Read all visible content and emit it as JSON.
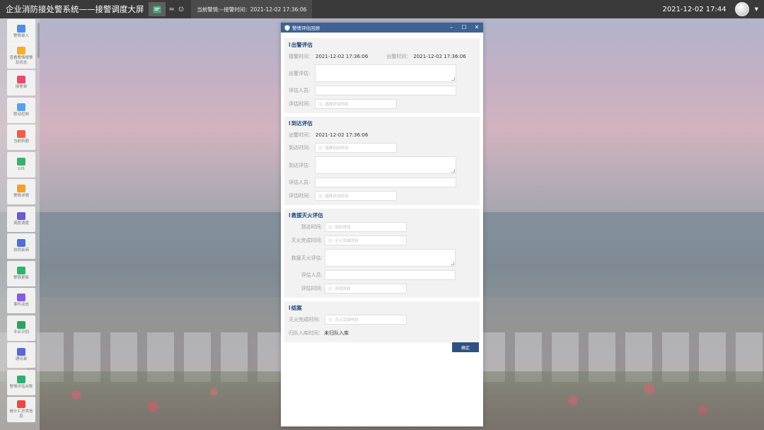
{
  "header": {
    "app_title": "企业消防接处警系统——接警调度大屏",
    "current_alert": "当前警情:--接警时间：2021-12-02 17:36:06",
    "datetime": "2021-12-02 17:44"
  },
  "sidebar": {
    "items": [
      {
        "label": "警情录入",
        "icon": "upload-icon",
        "color": "#4f8fe0"
      },
      {
        "label": "查看警情报警及状态",
        "icon": "bell-icon",
        "color": "#f0b030"
      },
      {
        "label": "接警单",
        "icon": "form-icon",
        "color": "#e84a6a"
      },
      {
        "label": "联动控制",
        "icon": "database-icon",
        "color": "#5aa0e8"
      },
      {
        "label": "当前执勤",
        "icon": "duty-icon",
        "color": "#e8604a"
      },
      {
        "label": "GIS",
        "icon": "map-pin-icon",
        "color": "#38b070"
      },
      {
        "label": "警情详情",
        "icon": "list-icon",
        "color": "#f0a030"
      },
      {
        "label": "调度调度",
        "icon": "hexagon-icon",
        "color": "#6a5ad0"
      },
      {
        "label": "协同会商",
        "icon": "meeting-icon",
        "color": "#4f70d0"
      },
      {
        "label": "警情更新",
        "icon": "refresh-icon",
        "color": "#30b070"
      },
      {
        "label": "事件动态",
        "icon": "share-icon",
        "color": "#8a5ae0"
      },
      {
        "label": "专业识别",
        "icon": "book-icon",
        "color": "#30a060"
      },
      {
        "label": "通讯录",
        "icon": "contacts-icon",
        "color": "#5a6ad0"
      },
      {
        "label": "警情评估台账",
        "icon": "evaluation-icon",
        "color": "#30b070"
      },
      {
        "label": "统计汇总类信息",
        "icon": "stats-icon",
        "color": "#e84a4a"
      }
    ]
  },
  "dialog": {
    "title": "警情评估回顾",
    "confirm_label": "确定",
    "sections": {
      "dispatch": {
        "title": "出警评估",
        "receive_label": "接警时间：",
        "receive_value": "2021-12-02 17:36:06",
        "dispatch_label": "出警时间：",
        "dispatch_value": "2021-12-02 17:36:06",
        "eval_label": "出警评估:",
        "person_label": "评估人员:",
        "time_label": "评估时间:",
        "time_placeholder": "选择评估时间"
      },
      "arrival": {
        "title": "到达评估",
        "dispatch_label": "出警时间：",
        "dispatch_value": "2021-12-02 17:36:06",
        "arrive_label": "到达时间:",
        "arrive_placeholder": "选择到达时间",
        "eval_label": "到达评估:",
        "person_label": "评估人员:",
        "time_label": "评估时间:",
        "time_placeholder": "选择评估时间"
      },
      "fire": {
        "title": "救援灭火评估",
        "arrive_label": "到达时间:",
        "arrive_placeholder": "到达时间",
        "done_label": "灭火完成时间:",
        "done_placeholder": "灭火完成时间",
        "eval_label": "救援灭火评估:",
        "person_label": "评估人员:",
        "time_label": "评估时间:",
        "time_placeholder": "评估时间"
      },
      "close": {
        "title": "结案",
        "done_label": "灭火完成时间:",
        "done_placeholder": "灭火完成时间",
        "return_label": "归队入库时间：",
        "return_value": "未归队入库"
      }
    }
  }
}
